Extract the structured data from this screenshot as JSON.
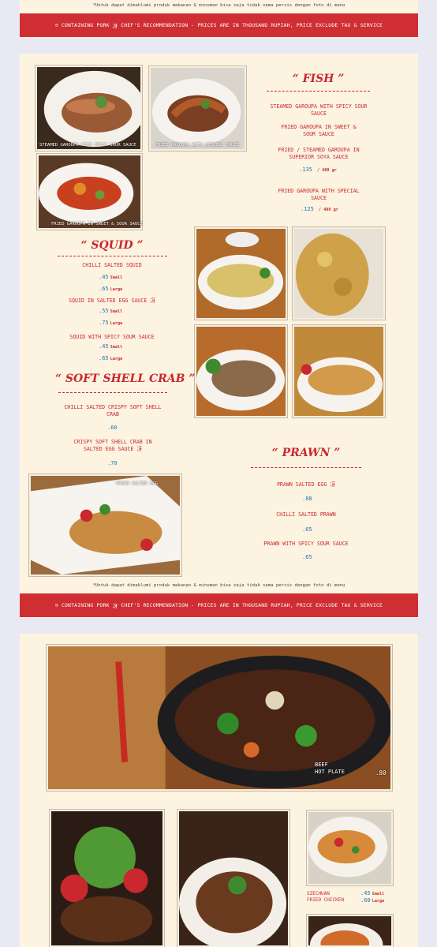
{
  "disclaimer_top": "*Untuk dapat dimaklumi produk makanan & minuman bisa saja tidak sama persis dengan foto di menu",
  "disclaimer_mid": "*Untuk dapat dimaklumi produk makanan & minuman bisa saja tidak sama persis dengan foto di menu",
  "banner": {
    "icon_pork": "☺",
    "pork_label": "CONTAINING PORK",
    "icon_chef": "冴",
    "chef_label": "CHEF'S RECOMMENDATION",
    "separator": "-",
    "prices_note": "PRICES ARE IN THOUSAND RUPIAH, PRICE EXCLUDE TAX & SERVICE"
  },
  "photos": {
    "steamed_garoupa": "STEAMED GAROUPA WITH SPICY SOUR SAUCE",
    "fried_garoupa": "FRIED GAROUPA WITH SPECIAL SAUCE",
    "fried_sweet_sour": "FRIED GAROUPA IN SWEET & SOUR SAUCE",
    "prawn_salted_egg": "PRAWN SALTED EGG"
  },
  "fish": {
    "heading": "“ FISH ”",
    "items": [
      {
        "name": "STEAMED GAROUPA WITH SPICY SOUR SAUCE",
        "mark": "冴"
      },
      {
        "name": "FRIED GAROUPA IN SWEET & SOUR SAUCE"
      },
      {
        "name": "FRIED / STEAMED GAROUPA IN SUPERIOR SOYA SAUCE"
      },
      {
        "name": "FRIED GAROUPA WITH SPECIAL SAUCE"
      }
    ],
    "price_a": ".135",
    "unit_a": "/ 400 gr",
    "price_b": ".125",
    "unit_b": "/ 400 gr"
  },
  "squid": {
    "heading": "“ SQUID ”",
    "item1": "CHILLI SALTED SQUID",
    "item1_small": ".45",
    "item1_large": ".65",
    "item2": "SQUID IN SALTED EGG SAUCE 冴",
    "item2_small": ".55",
    "item2_large": ".75",
    "item3": "SQUID WITH SPICY SOUR SAUCE",
    "item3_small": ".45",
    "item3_large": ".65",
    "small_label": "Small",
    "large_label": "Large"
  },
  "softshell": {
    "heading": "“ SOFT SHELL CRAB ”",
    "item1": "CHILLI SALTED CRISPY SOFT SHELL CRAB",
    "item1_price": ".60",
    "item2": "CRISPY SOFT SHELL CRAB IN SALTED EGG SAUCE 冴",
    "item2_price": ".70"
  },
  "prawn": {
    "heading": "“ PRAWN ”",
    "item1": "PRAWN SALTED EGG 冴",
    "item1_price": ".88",
    "item2": "CHILLI SALTED PRAWN",
    "item2_price": ".65",
    "item3": "PRAWN WITH SPICY SOUR SAUCE",
    "item3_price": ".65"
  },
  "beef": {
    "name_line1": "BEEF",
    "name_line2": "HOT PLATE",
    "price": ".80"
  },
  "chicken": {
    "name_line1": "SZECHUAN",
    "name_line2": "FRIED CHICKEN",
    "small_price": ".45",
    "large_price": ".60",
    "small_label": "Small",
    "large_label": "Large"
  },
  "colors": {
    "accent": "#cf2e33",
    "price": "#1f77b4",
    "paper": "#fdf3e1"
  }
}
